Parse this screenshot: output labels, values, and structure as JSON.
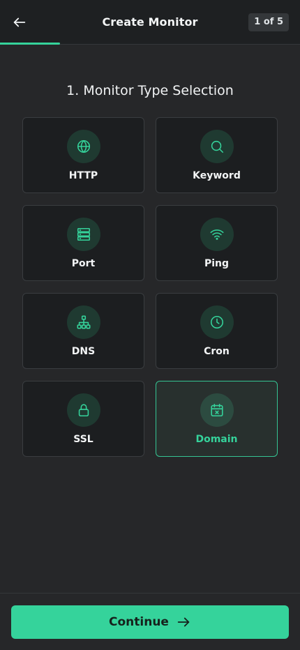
{
  "header": {
    "title": "Create Monitor",
    "step_badge": "1 of 5",
    "progress_fraction": 0.2
  },
  "section": {
    "title": "1. Monitor Type Selection"
  },
  "monitor_types": [
    {
      "label": "HTTP",
      "icon": "globe-icon",
      "selected": false
    },
    {
      "label": "Keyword",
      "icon": "search-icon",
      "selected": false
    },
    {
      "label": "Port",
      "icon": "server-icon",
      "selected": false
    },
    {
      "label": "Ping",
      "icon": "wifi-icon",
      "selected": false
    },
    {
      "label": "DNS",
      "icon": "sitemap-icon",
      "selected": false
    },
    {
      "label": "Cron",
      "icon": "clock-icon",
      "selected": false
    },
    {
      "label": "SSL",
      "icon": "lock-icon",
      "selected": false
    },
    {
      "label": "Domain",
      "icon": "calendar-x-icon",
      "selected": true
    }
  ],
  "footer": {
    "continue_label": "Continue"
  },
  "colors": {
    "accent": "#35d39b",
    "background": "#262729",
    "card": "#1c1e20",
    "icon_bg": "#1f3a31"
  }
}
